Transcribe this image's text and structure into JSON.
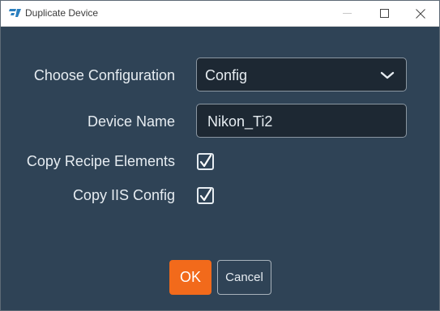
{
  "window": {
    "title": "Duplicate Device"
  },
  "form": {
    "configuration_label": "Choose Configuration",
    "configuration_value": "Config",
    "device_name_label": "Device Name",
    "device_name_value": "Nikon_Ti2",
    "copy_recipe_label": "Copy Recipe Elements",
    "copy_recipe_checked": true,
    "copy_iis_label": "Copy IIS Config",
    "copy_iis_checked": true
  },
  "buttons": {
    "ok_label": "OK",
    "cancel_label": "Cancel"
  },
  "colors": {
    "background": "#2f4356",
    "field_background": "#1d2833",
    "accent": "#f26a1b",
    "text": "#e6ecf1"
  },
  "icons": {
    "app": "app-logo-icon",
    "minimize": "minimize-icon",
    "maximize": "maximize-icon",
    "close": "close-icon",
    "dropdown": "chevron-down-icon",
    "check": "checkmark-icon"
  }
}
